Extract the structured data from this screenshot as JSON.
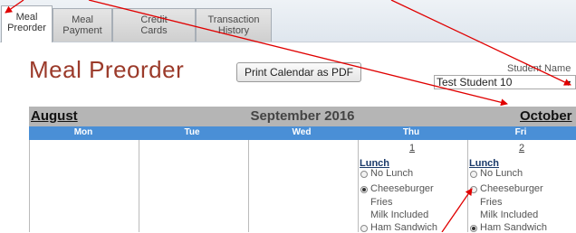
{
  "tabs": [
    {
      "label_line1": "Meal",
      "label_line2": "Preorder"
    },
    {
      "label_line1": "Meal",
      "label_line2": "Payment"
    },
    {
      "label_line1": "Credit",
      "label_line2": "Cards"
    },
    {
      "label_line1": "Transaction",
      "label_line2": "History"
    }
  ],
  "page": {
    "title": "Meal Preorder",
    "print_button": "Print Calendar as PDF",
    "student_label": "Student Name",
    "student_selected": "Test Student 10"
  },
  "calendar": {
    "prev_month": "August",
    "current_month": "September 2016",
    "next_month": "October",
    "days": [
      "Mon",
      "Tue",
      "Wed",
      "Thu",
      "Fri"
    ],
    "thu": {
      "date": "1",
      "meal": "Lunch",
      "options": [
        {
          "label": "No Lunch",
          "checked": false
        },
        {
          "label": "Cheeseburger",
          "checked": true,
          "sub1": "Fries",
          "sub2": "Milk Included"
        },
        {
          "label": "Ham Sandwich",
          "checked": false
        }
      ]
    },
    "fri": {
      "date": "2",
      "meal": "Lunch",
      "options": [
        {
          "label": "No Lunch",
          "checked": false
        },
        {
          "label": "Cheeseburger",
          "checked": false,
          "sub1": "Fries",
          "sub2": "Milk Included"
        },
        {
          "label": "Ham Sandwich",
          "checked": true
        }
      ]
    }
  },
  "colors": {
    "title": "#9b3a2a",
    "day_header": "#4a8fd6",
    "month_header": "#b5b5b5",
    "annotation_arrow": "#e00000"
  }
}
